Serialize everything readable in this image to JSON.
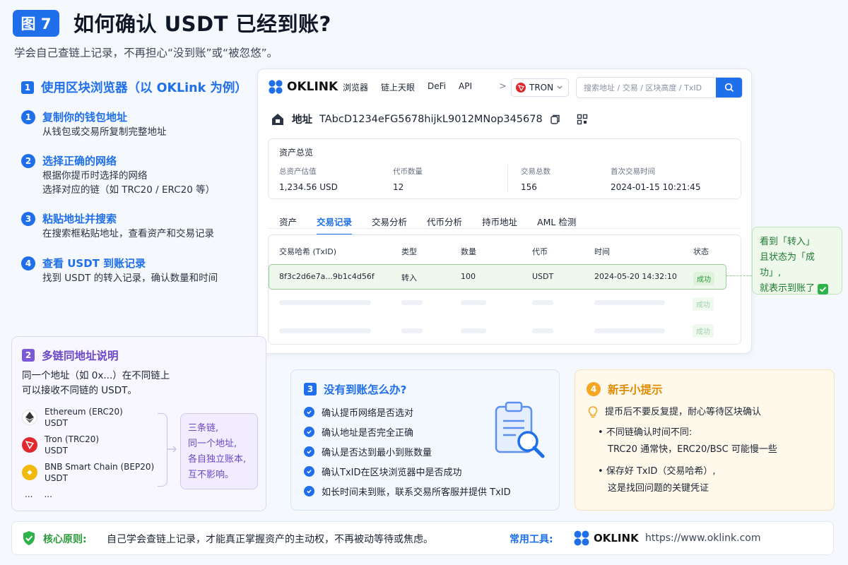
{
  "header": {
    "figure_badge": "图 7",
    "title": "如何确认 USDT 已经到账?",
    "subtitle": "学会自己查链上记录，不再担心“没到账”或“被忽悠”。"
  },
  "section1": {
    "number": "1",
    "title": "使用区块浏览器（以 OKLink 为例）",
    "steps": [
      {
        "num": "1",
        "title": "复制你的钱包地址",
        "desc": [
          "从钱包或交易所复制完整地址"
        ]
      },
      {
        "num": "2",
        "title": "选择正确的网络",
        "desc": [
          "根据你提币时选择的网络",
          "选择对应的链（如 TRC20 / ERC20 等）"
        ]
      },
      {
        "num": "3",
        "title": "粘贴地址并搜索",
        "desc": [
          "在搜索框粘贴地址，查看资产和交易记录"
        ]
      },
      {
        "num": "4",
        "title": "查看 USDT 到账记录",
        "desc": [
          "找到 USDT 的转入记录，确认数量和时间"
        ]
      }
    ]
  },
  "browser": {
    "logo_text": "OKLINK",
    "nav": [
      "浏览器",
      "链上天眼",
      "DeFi",
      "API"
    ],
    "chevron": ">",
    "network": "TRON",
    "search_placeholder": "搜索地址 / 交易 / 区块高度 / TxID",
    "address_label": "地址",
    "address": "TAbcD1234eFG5678hijkL9012MNop345678",
    "asset_overview": {
      "title": "资产总览",
      "items": [
        {
          "label": "总资产估值",
          "value": "1,234.56 USD"
        },
        {
          "label": "代币数量",
          "value": "12"
        },
        {
          "label": "交易总数",
          "value": "156"
        },
        {
          "label": "首次交易时间",
          "value": "2024-01-15 10:21:45"
        }
      ]
    },
    "tabs": [
      "资产",
      "交易记录",
      "交易分析",
      "代币分析",
      "持币地址",
      "AML 检测"
    ],
    "active_tab": "交易记录",
    "table": {
      "headers": [
        "交易哈希 (TxID)",
        "类型",
        "数量",
        "代币",
        "时间",
        "状态"
      ],
      "row": {
        "txid": "8f3c2d6e7a...9b1c4d56f",
        "type": "转入",
        "amount": "100",
        "token": "USDT",
        "time": "2024-05-20 14:32:10",
        "status": "成功"
      },
      "faded_status": "成功"
    }
  },
  "callout": {
    "lines": [
      "看到「转入」",
      "且状态为「成功」,",
      "就表示到账了"
    ]
  },
  "section2": {
    "number": "2",
    "title": "多链同地址说明",
    "desc": [
      "同一个地址（如 0x...）在不同链上",
      "可以接收不同链的 USDT。"
    ],
    "chains": [
      {
        "name": "Ethereum (ERC20)",
        "token": "USDT",
        "color": "#ffffff"
      },
      {
        "name": "Tron (TRC20)",
        "token": "USDT",
        "color": "#e0282e"
      },
      {
        "name": "BNB Smart Chain (BEP20)",
        "token": "USDT",
        "color": "#f0b90b"
      }
    ],
    "ellipsis_a": "...",
    "ellipsis_b": "...",
    "note": [
      "三条链,",
      "同一个地址,",
      "各自独立账本,",
      "互不影响。"
    ]
  },
  "section3": {
    "number": "3",
    "title": "没有到账怎么办?",
    "items": [
      "确认提币网络是否选对",
      "确认地址是否完全正确",
      "确认是否达到最小到账数量",
      "确认TxID在区块浏览器中是否成功",
      "如长时间未到账，联系交易所客服并提供 TxID"
    ]
  },
  "section4": {
    "number": "4",
    "title": "新手小提示",
    "tip": "提币后不要反复提，耐心等待区块确认",
    "bullets": [
      [
        "不同链确认时间不同:",
        "TRC20 通常快，ERC20/BSC 可能慢一些"
      ],
      [
        "保存好 TxID（交易哈希）,",
        "这是找回问题的关键凭证"
      ]
    ]
  },
  "footer": {
    "principle_label": "核心原则:",
    "principle_text": "自己学会查链上记录，才能真正掌握资产的主动权，不再被动等待或焦虑。",
    "tools_label": "常用工具:",
    "logo_text": "OKLINK",
    "url": "https://www.oklink.com"
  },
  "colors": {
    "primary": "#1f6feb",
    "success": "#2a9a39",
    "purple": "#6a46c8",
    "orange": "#f5a623",
    "tron_red": "#e0282e"
  }
}
